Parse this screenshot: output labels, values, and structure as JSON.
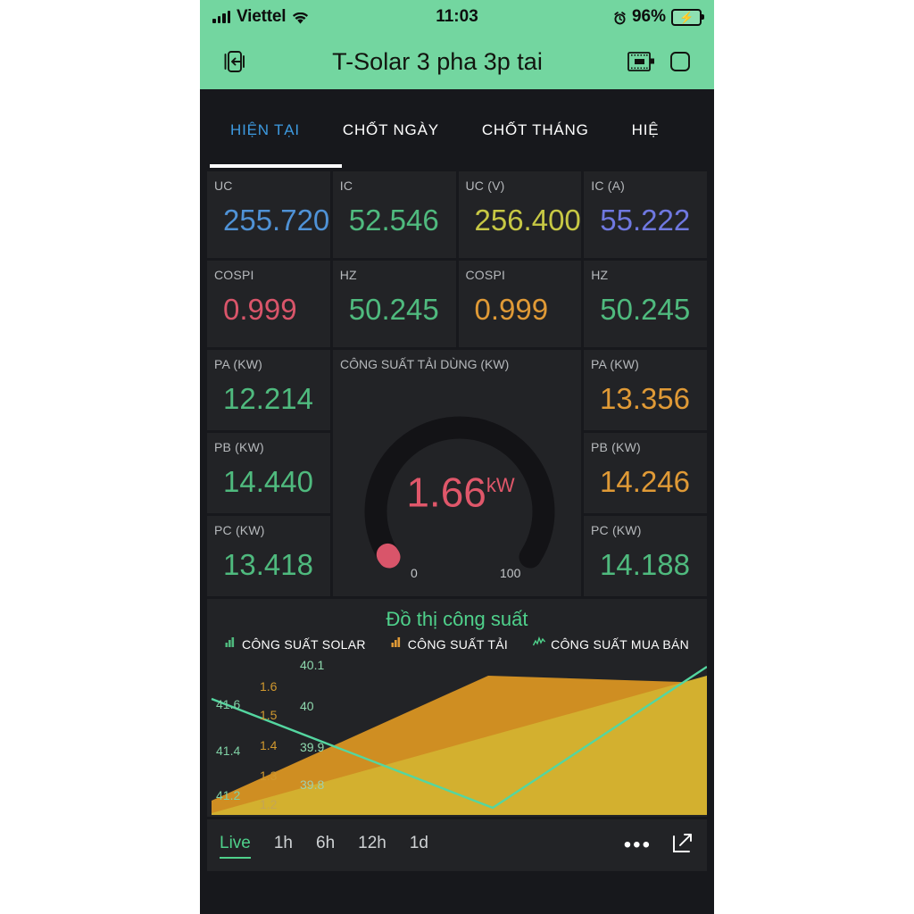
{
  "status_bar": {
    "carrier": "Viettel",
    "time": "11:03",
    "battery_pct": "96%",
    "icons": [
      "signal-bars-icon",
      "wifi-icon",
      "alarm-icon",
      "battery-charging-icon"
    ]
  },
  "app_bar": {
    "title": "T-Solar 3 pha 3p tai",
    "back_icon": "exit-left-icon",
    "device_icon": "chip-icon",
    "square_icon": "rounded-square-icon"
  },
  "tabs": [
    {
      "label": "HIỆN TẠI",
      "active": true
    },
    {
      "label": "CHỐT NGÀY",
      "active": false
    },
    {
      "label": "CHỐT THÁNG",
      "active": false
    },
    {
      "label": "HIỆ",
      "active": false
    }
  ],
  "metrics_row1": [
    {
      "label": "UC",
      "value": "255.720",
      "color": "#4f92d6"
    },
    {
      "label": "IC",
      "value": "52.546",
      "color": "#4fba7e"
    },
    {
      "label": "UC (V)",
      "value": "256.400",
      "color": "#c7c844"
    },
    {
      "label": "IC (A)",
      "value": "55.222",
      "color": "#6f78e0"
    }
  ],
  "metrics_row2": [
    {
      "label": "COSPI",
      "value": "0.999",
      "color": "#d9556a"
    },
    {
      "label": "HZ",
      "value": "50.245",
      "color": "#4fba7e"
    },
    {
      "label": "COSPI",
      "value": "0.999",
      "color": "#e09a36"
    },
    {
      "label": "HZ",
      "value": "50.245",
      "color": "#4fba7e"
    }
  ],
  "left_column": [
    {
      "label": "PA (KW)",
      "value": "12.214",
      "color": "#4fba7e"
    },
    {
      "label": "PB (KW)",
      "value": "14.440",
      "color": "#4fba7e"
    },
    {
      "label": "PC (KW)",
      "value": "13.418",
      "color": "#4fba7e"
    }
  ],
  "right_column": [
    {
      "label": "PA (KW)",
      "value": "13.356",
      "color": "#e09a36"
    },
    {
      "label": "PB (KW)",
      "value": "14.246",
      "color": "#e09a36"
    },
    {
      "label": "PC (KW)",
      "value": "14.188",
      "color": "#4fba7e"
    }
  ],
  "gauge": {
    "label": "CÔNG SUẤT TẢI DÙNG (KW)",
    "value": "1.66",
    "unit": "kW",
    "min": "0",
    "max": "100",
    "value_color": "#e0576a",
    "track_color": "#131316",
    "percent": 1.66
  },
  "chart_data": {
    "type": "area",
    "title": "Đồ thị công suất",
    "xlabel": "",
    "ylabel": "",
    "grid": false,
    "legend_position": "top",
    "legend": [
      {
        "name": "CÔNG SUẤT SOLAR",
        "color": "#4fba7e",
        "icon": "bar-chart-icon"
      },
      {
        "name": "CÔNG SUẤT TẢI",
        "color": "#e09a36",
        "icon": "bar-chart-icon"
      },
      {
        "name": "CÔNG SUẤT MUA BÁN",
        "color": "#4fd18b",
        "icon": "line-chart-icon"
      }
    ],
    "axes": [
      {
        "name": "CÔNG SUẤT SOLAR",
        "color": "#4fba7e",
        "ticks": [
          "41.6",
          "41.4",
          "41.2"
        ],
        "range": [
          41.1,
          41.75
        ]
      },
      {
        "name": "CÔNG SUẤT TẢI",
        "color": "#d0982f",
        "ticks": [
          "1.6",
          "1.5",
          "1.4",
          "1.3",
          "1.2"
        ],
        "range": [
          1.15,
          1.65
        ]
      },
      {
        "name": "CÔNG SUẤT MUA BÁN",
        "color": "#8fd9ae",
        "ticks": [
          "40.1",
          "40",
          "39.9",
          "39.8"
        ],
        "range": [
          39.75,
          40.15
        ]
      }
    ],
    "series": [
      {
        "name": "CÔNG SUẤT TẢI",
        "color": "#d08a1e",
        "fill": "#cf8e22",
        "type": "area",
        "x": [
          0,
          0.5,
          1.0
        ],
        "values": [
          1.2,
          1.62,
          1.63
        ]
      },
      {
        "name": "CÔNG SUẤT SOLAR",
        "color": "#d4b02e",
        "fill": "#d3b02f",
        "type": "area",
        "x": [
          0,
          1.0
        ],
        "values": [
          41.15,
          41.72
        ]
      },
      {
        "name": "CÔNG SUẤT MUA BÁN",
        "color": "#54d6a0",
        "type": "line",
        "x": [
          0,
          0.58,
          1.0
        ],
        "values": [
          40.08,
          39.76,
          40.14
        ]
      }
    ]
  },
  "footer": {
    "ranges": [
      {
        "label": "Live",
        "active": true
      },
      {
        "label": "1h",
        "active": false
      },
      {
        "label": "6h",
        "active": false
      },
      {
        "label": "12h",
        "active": false
      },
      {
        "label": "1d",
        "active": false
      }
    ],
    "more_icon": "more-dots-icon",
    "expand_icon": "external-link-icon"
  }
}
